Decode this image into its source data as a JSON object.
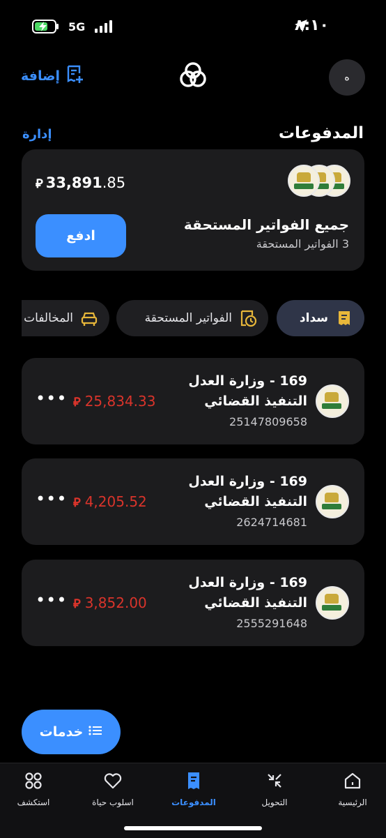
{
  "status_bar": {
    "time": "٨:١٠",
    "network": "5G"
  },
  "header": {
    "add_label": "إضافة",
    "avatar_initial": "ه"
  },
  "payments": {
    "title": "المدفوعات",
    "manage_label": "إدارة",
    "summary": {
      "amount_int": "33,891",
      "amount_dec": ".85",
      "currency_symbol": "⃁",
      "pay_label": "ادفع",
      "title": "جميع الفواتير المستحقة",
      "subtitle": "3 الفواتير المستحقة"
    }
  },
  "chips": [
    {
      "label": "سداد",
      "icon": "receipt-icon",
      "active": true
    },
    {
      "label": "الفواتير المستحقة",
      "icon": "bill-clock-icon",
      "active": false
    },
    {
      "label": "المخالفات",
      "icon": "car-icon",
      "active": false
    }
  ],
  "bills": [
    {
      "line1": "169 - وزارة العدل",
      "line2": "التنفيذ القضائي",
      "number": "25147809658",
      "amount": "25,834.33"
    },
    {
      "line1": "169 - وزارة العدل",
      "line2": "التنفيذ القضائي",
      "number": "2624714681",
      "amount": "4,205.52"
    },
    {
      "line1": "169 - وزارة العدل",
      "line2": "التنفيذ القضائي",
      "number": "2555291648",
      "amount": "3,852.00"
    }
  ],
  "bill_currency": "⃁",
  "services_label": "خدمات",
  "nav": [
    {
      "label": "الرئيسية",
      "icon": "home-icon"
    },
    {
      "label": "التحويل",
      "icon": "transfer-icon"
    },
    {
      "label": "المدفوعات",
      "icon": "payments-icon",
      "active": true
    },
    {
      "label": "اسلوب حياة",
      "icon": "heart-icon"
    },
    {
      "label": "استكشف",
      "icon": "explore-icon"
    }
  ],
  "colors": {
    "accent": "#3b8fff",
    "amount_red": "#d9342b",
    "card_bg": "#1c1c1e"
  }
}
